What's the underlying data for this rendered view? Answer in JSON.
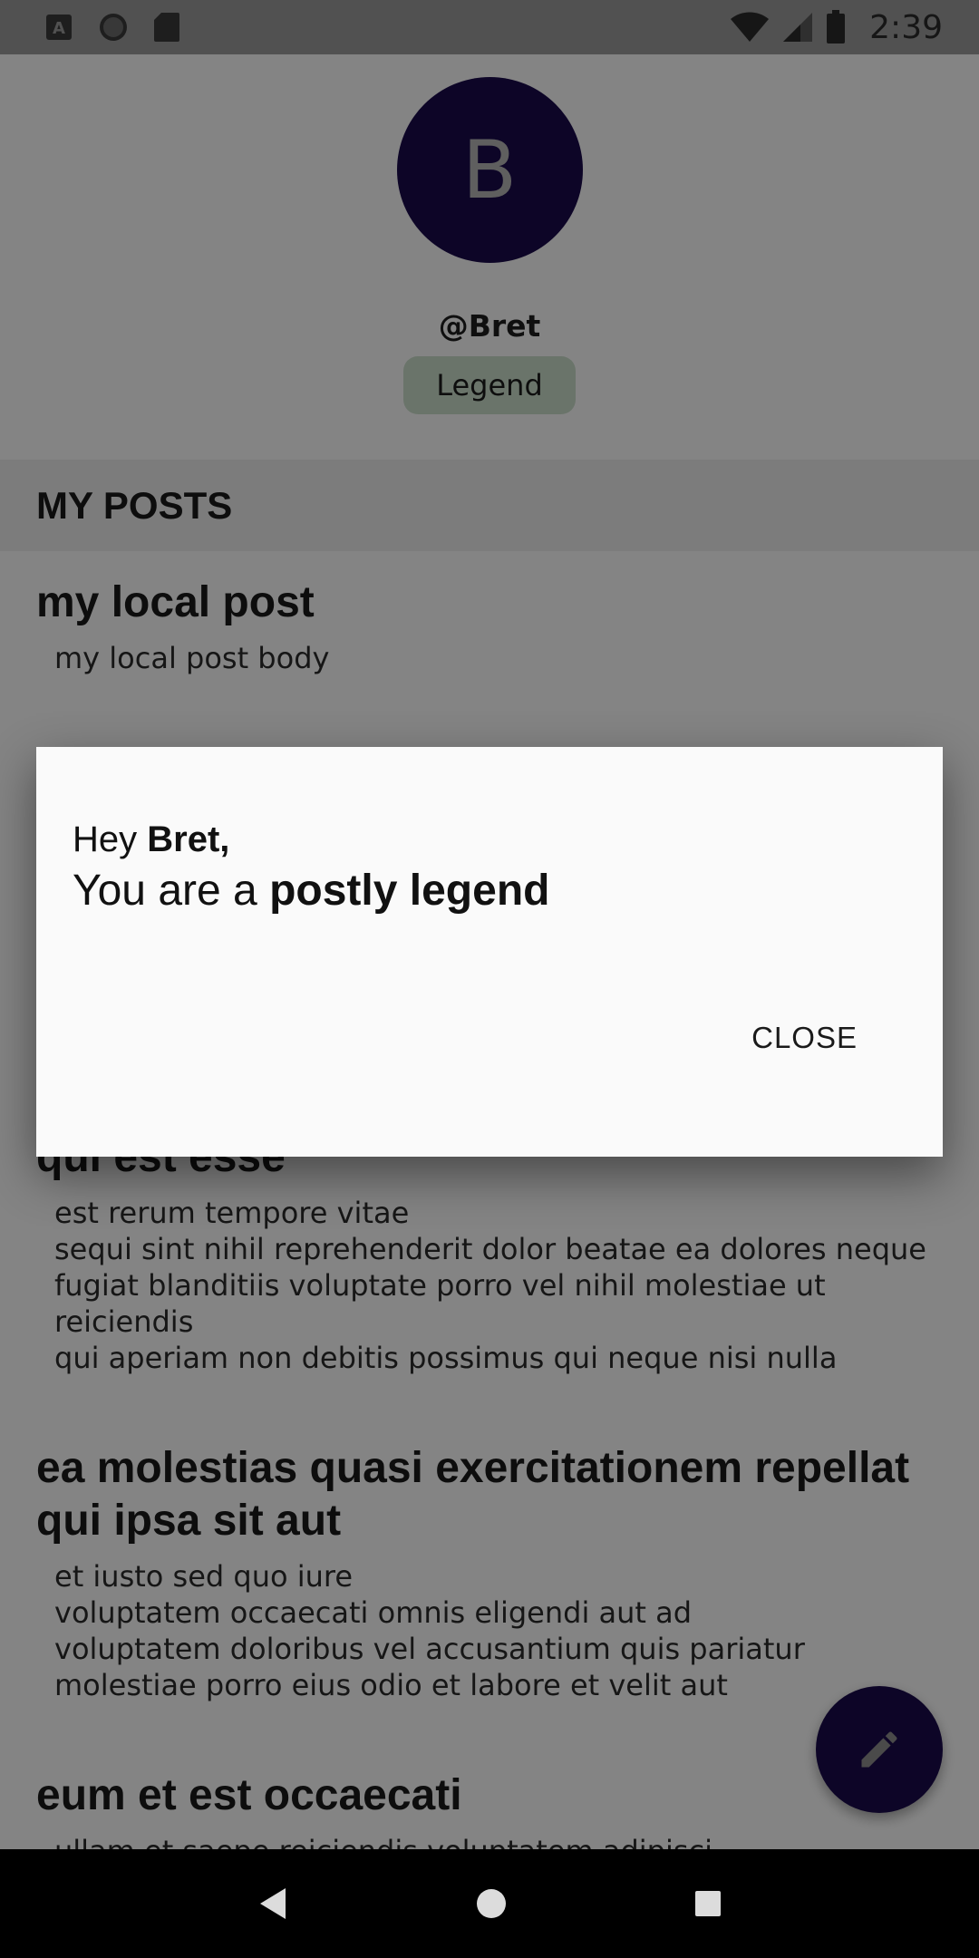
{
  "status_bar": {
    "time": "2:39",
    "icons": [
      "a-icon",
      "circle-icon",
      "sd-card-icon",
      "wifi-icon",
      "signal-icon",
      "battery-icon"
    ]
  },
  "profile": {
    "avatar_initial": "B",
    "handle": "@Bret",
    "badge": "Legend"
  },
  "section": {
    "title": "MY POSTS"
  },
  "posts": [
    {
      "title": "my local post",
      "body": "my local post body"
    },
    {
      "title": "qui est esse",
      "body": "est rerum tempore vitae\nsequi sint nihil reprehenderit dolor beatae ea dolores neque\nfugiat blanditiis voluptate porro vel nihil molestiae ut reiciendis\nqui aperiam non debitis possimus qui neque nisi nulla"
    },
    {
      "title": "ea molestias quasi exercitationem repellat qui ipsa sit aut",
      "body": "et iusto sed quo iure\nvoluptatem occaecati omnis eligendi aut ad\nvoluptatem doloribus vel accusantium quis pariatur\nmolestiae porro eius odio et labore et velit aut"
    },
    {
      "title": "eum et est occaecati",
      "body": "ullam et saepe reiciendis voluptatem adipisci"
    }
  ],
  "dialog": {
    "greeting_prefix": "Hey ",
    "greeting_name": "Bret,",
    "message_prefix": "You are a ",
    "message_bold": "postly legend",
    "close_label": "CLOSE"
  },
  "fab": {
    "icon": "pencil-icon"
  },
  "nav_bar": {
    "icons": [
      "back-icon",
      "home-icon",
      "recents-icon"
    ]
  },
  "colors": {
    "primary": "#1a0a4a",
    "badge_bg": "#c8dcc8",
    "scrim": "rgba(0,0,0,0.47)"
  }
}
